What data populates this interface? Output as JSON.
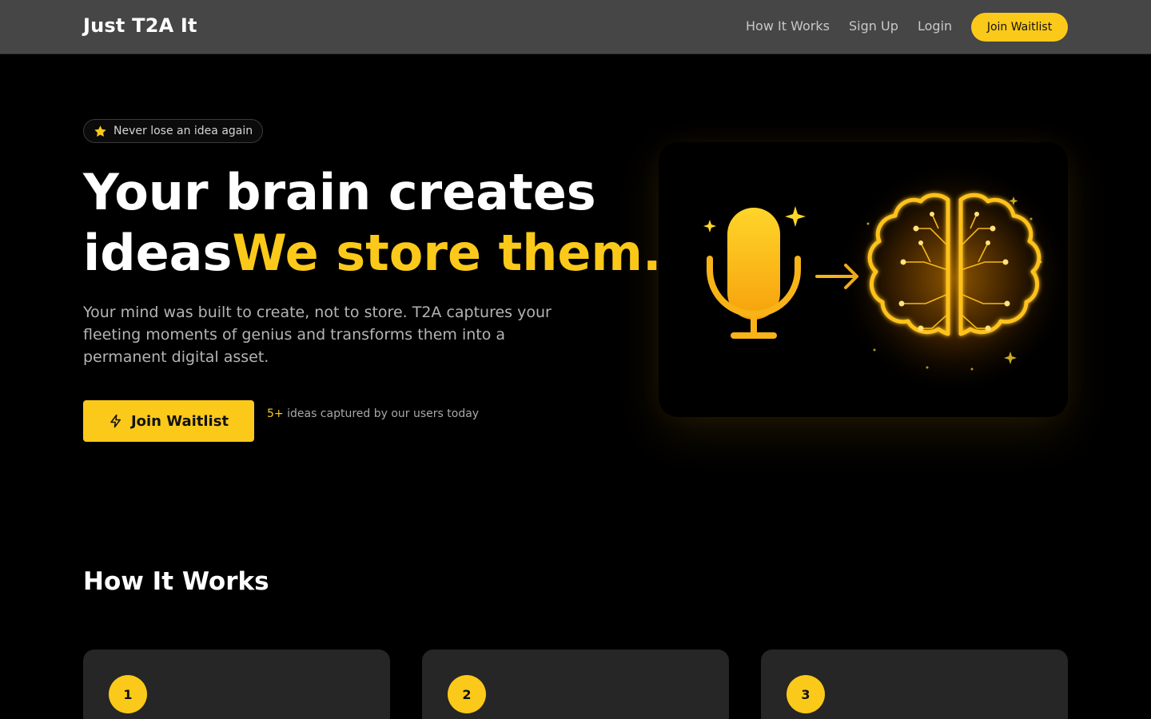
{
  "brand": "Just T2A It",
  "nav": {
    "links": [
      "How It Works",
      "Sign Up",
      "Login"
    ],
    "cta": "Join Waitlist"
  },
  "hero": {
    "badge": "Never lose an idea again",
    "badge_icon": "star-icon",
    "headline_line1": "Your brain creates",
    "headline_line2_part1": "ideas",
    "headline_line2_accent": "We store them.",
    "subtext": "Your mind was built to create, not to store. T2A captures your fleeting moments of genius and transforms them into a permanent digital asset.",
    "cta_label": "Join Waitlist",
    "cta_icon": "lightning-icon",
    "stat_number": "5+",
    "stat_text": "ideas captured by our users today",
    "illustration_icons": [
      "microphone-icon",
      "arrow-right-icon",
      "brain-circuit-icon"
    ]
  },
  "how_it_works": {
    "title": "How It Works",
    "steps": [
      "1",
      "2",
      "3"
    ]
  },
  "colors": {
    "accent": "#fbc919",
    "nav_bg": "#464646",
    "page_bg": "#000000",
    "card_bg": "#262626"
  }
}
